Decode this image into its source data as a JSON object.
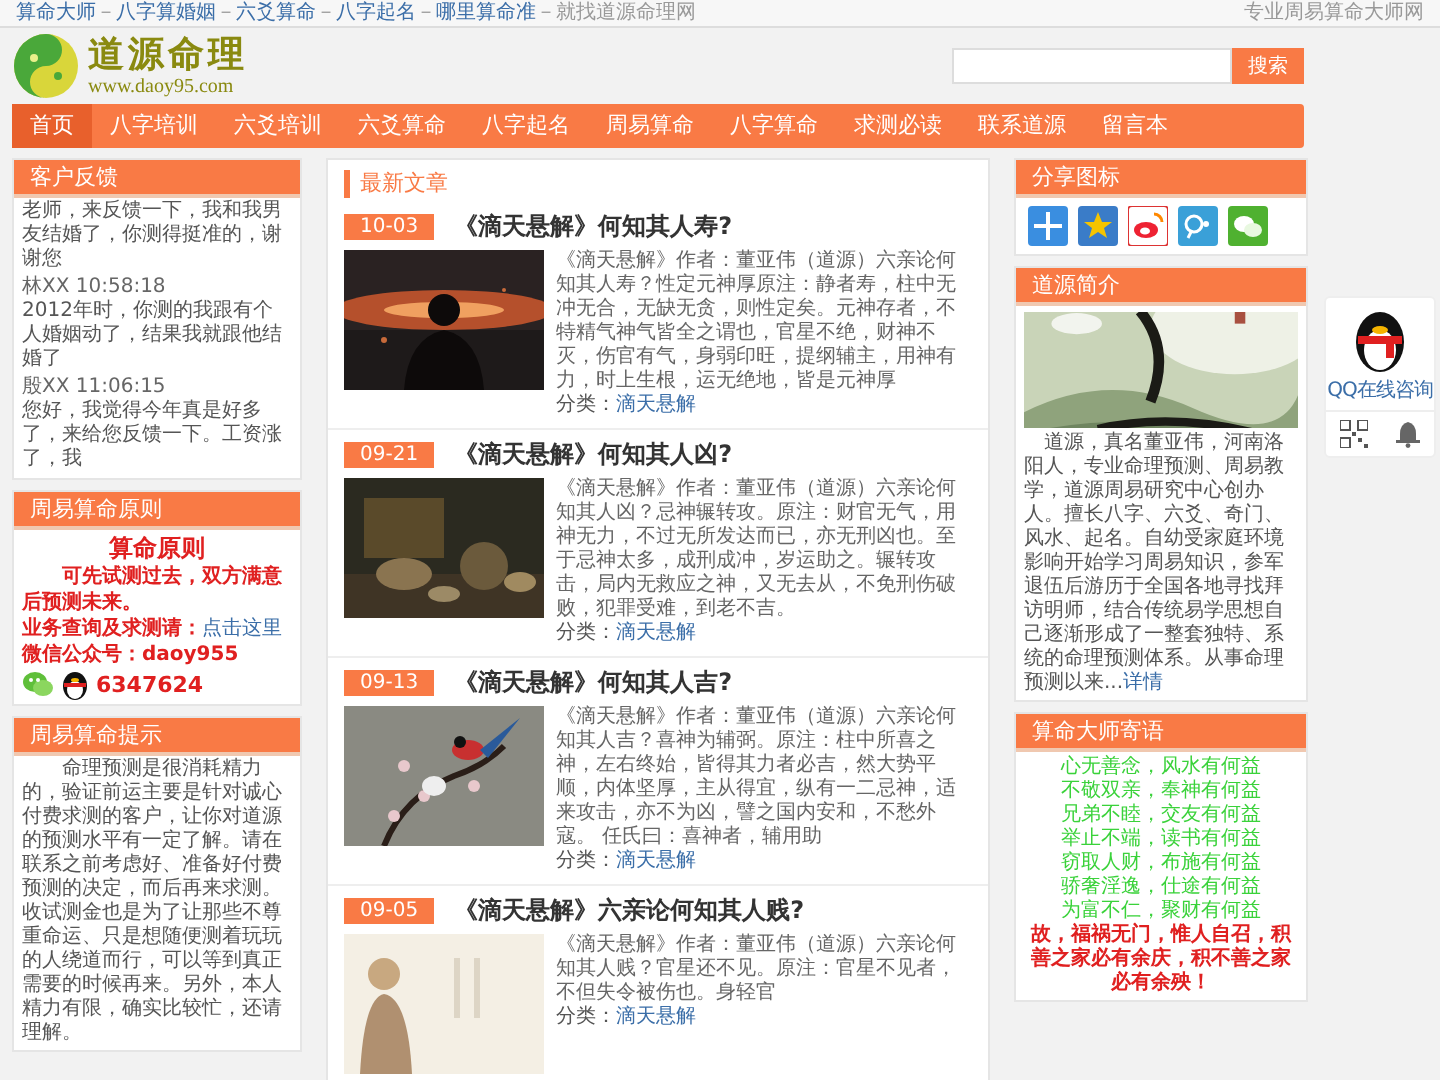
{
  "top_bar": {
    "links": [
      "算命大师",
      "八字算婚姻",
      "六爻算命",
      "八字起名",
      "哪里算命准"
    ],
    "separator": "－",
    "tail": "就找道源命理网",
    "tagline": "专业周易算命大师网"
  },
  "logo": {
    "name": "道源命理",
    "url": "www.daoy95.com"
  },
  "search": {
    "button": "搜索"
  },
  "nav": [
    {
      "label": "首页",
      "selected": true
    },
    {
      "label": "八字培训",
      "selected": false
    },
    {
      "label": "六爻培训",
      "selected": false
    },
    {
      "label": "六爻算命",
      "selected": false
    },
    {
      "label": "八字起名",
      "selected": false
    },
    {
      "label": "周易算命",
      "selected": false
    },
    {
      "label": "八字算命",
      "selected": false
    },
    {
      "label": "求测必读",
      "selected": false
    },
    {
      "label": "联系道源",
      "selected": false
    },
    {
      "label": "留言本",
      "selected": false
    }
  ],
  "feedback": {
    "title": "客户反馈",
    "entries": [
      {
        "text": "老师，来反馈一下，我和我男友结婚了，你测得挺准的，谢谢您"
      },
      {
        "author": "林XX 10:58:18",
        "text": "2012年时，你测的我跟有个人婚姻动了，结果我就跟他结婚了"
      },
      {
        "author": "殷XX 11:06:15",
        "text": "您好，我觉得今年真是好多了，来给您反馈一下。工资涨了，我"
      }
    ]
  },
  "principle": {
    "title": "周易算命原则",
    "heading": "算命原则",
    "promise": "可先试测过去，双方满意后预测未来。",
    "contact_label": "业务查询及求测请：",
    "contact_link": "点击这里",
    "wechat": "微信公众号：daoy955",
    "qq": "6347624"
  },
  "tips": {
    "title": "周易算命提示",
    "text": "命理预测是很消耗精力的，验证前运主要是针对诚心付费求测的客户，让你对道源的预测水平有一定了解。请在联系之前考虑好、准备好付费预测的决定，而后再来求测。收试测金也是为了让那些不尊重命运、只是想随便测着玩玩的人绕道而行，可以等到真正需要的时候再来。另外，本人精力有限，确实比较忙，还请理解。"
  },
  "articles": {
    "title": "最新文章",
    "items": [
      {
        "date": "10-03",
        "title": "《滴天悬解》何知其人寿?",
        "summary": "《滴天悬解》作者：董亚伟（道源）六亲论何知其人寿？性定元神厚原注：静者寿，柱中无冲无合，无缺无贪，则性定矣。元神存者，不特精气神气皆全之谓也，官星不绝，财神不灭，伤官有气，身弱印旺，提纲辅主，用神有力，时上生根，运无绝地，皆是元神厚",
        "category_label": "分类：",
        "category": "滴天悬解"
      },
      {
        "date": "09-21",
        "title": "《滴天悬解》何知其人凶?",
        "summary": "《滴天悬解》作者：董亚伟（道源）六亲论何知其人凶？忌神辗转攻。原注：财官无气，用神无力，不过无所发达而已，亦无刑凶也。至于忌神太多，成刑成冲，岁运助之。辗转攻击，局内无救应之神，又无去从，不免刑伤破败，犯罪受难，到老不吉。",
        "category_label": "分类：",
        "category": "滴天悬解"
      },
      {
        "date": "09-13",
        "title": "《滴天悬解》何知其人吉?",
        "summary": "《滴天悬解》作者：董亚伟（道源）六亲论何知其人吉？喜神为辅弼。原注：柱中所喜之神，左右终始，皆得其力者必吉，然大势平顺，内体坚厚，主从得宜，纵有一二忌神，适来攻击，亦不为凶，譬之国内安和，不愁外寇。 任氏曰：喜神者，辅用助",
        "category_label": "分类：",
        "category": "滴天悬解"
      },
      {
        "date": "09-05",
        "title": "《滴天悬解》六亲论何知其人贱?",
        "summary": "《滴天悬解》作者：董亚伟（道源）六亲论何知其人贱？官星还不见。原注：官星不见者，不但失令被伤也。身轻官",
        "category_label": "分类：",
        "category": "滴天悬解"
      }
    ]
  },
  "share": {
    "title": "分享图标"
  },
  "intro": {
    "title": "道源简介",
    "text": "道源，真名董亚伟，河南洛阳人，专业命理预测、周易教学，道源周易研究中心创办人。擅长八字、六爻、奇门、风水、起名。自幼受家庭环境影响开始学习周易知识，参军退伍后游历于全国各地寻找拜访明师，结合传统易学思想自己逐渐形成了一整套独特、系统的命理预测体系。从事命理预测以来...",
    "more": "详情"
  },
  "motto": {
    "title": "算命大师寄语",
    "lines": [
      "心无善念，风水有何益",
      "不敬双亲，奉神有何益",
      "兄弟不睦，交友有何益",
      "举止不端，读书有何益",
      "窃取人财，布施有何益",
      "骄奢淫逸，仕途有何益",
      "为富不仁，聚财有何益"
    ],
    "closing": "故，福祸无门，惟人自召，积善之家必有余庆，积不善之家必有余殃！"
  },
  "qq_widget": {
    "label": "QQ在线咨询"
  }
}
